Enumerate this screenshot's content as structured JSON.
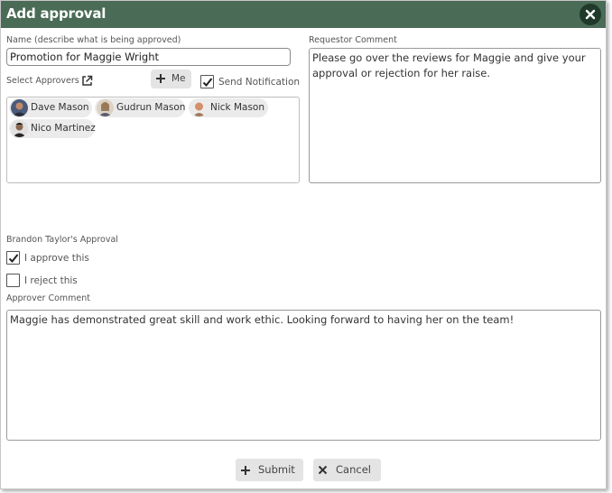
{
  "dialog": {
    "title": "Add approval",
    "close_icon": "close-icon"
  },
  "name_field": {
    "label": "Name (describe what is being approved)",
    "value": "Promotion for Maggie Wright"
  },
  "requestor_comment": {
    "label": "Requestor Comment",
    "value": "Please go over the reviews for Maggie and give your approval or rejection for her raise."
  },
  "approvers": {
    "label": "Select Approvers",
    "open_icon": "external-link-icon",
    "me_button": "Me",
    "send_notification": {
      "label": "Send Notification",
      "checked": true
    },
    "chips": [
      {
        "name": "Dave Mason",
        "avatar_color": "#6b4a3a"
      },
      {
        "name": "Gudrun Mason",
        "avatar_color": "#b89a7a"
      },
      {
        "name": "Nick Mason",
        "avatar_color": "#c98a6a"
      },
      {
        "name": "Nico Martinez",
        "avatar_color": "#3a3330"
      }
    ]
  },
  "approval": {
    "heading": "Brandon Taylor's Approval",
    "approve": {
      "label": "I approve this",
      "checked": true
    },
    "reject": {
      "label": "I reject this",
      "checked": false
    },
    "comment_label": "Approver Comment",
    "comment_value": "Maggie has demonstrated great skill and work ethic. Looking forward to having her on the team!"
  },
  "footer": {
    "submit_label": "Submit",
    "cancel_label": "Cancel"
  },
  "colors": {
    "titlebar": "#4a6b56",
    "close_button": "#1f3a2a",
    "button_bg": "#e4e4e4"
  }
}
